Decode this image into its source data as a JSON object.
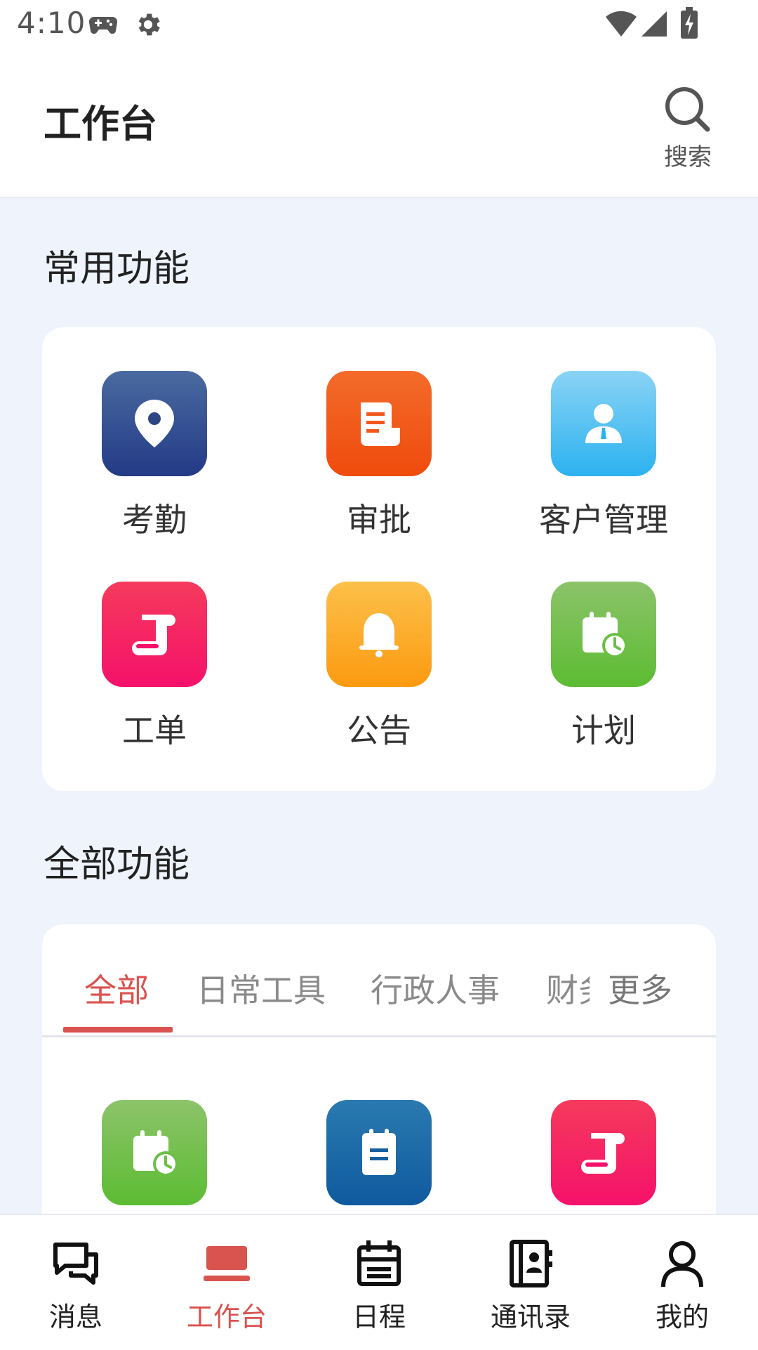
{
  "status_bar": {
    "time": "4:10"
  },
  "header": {
    "title": "工作台",
    "search_label": "搜索"
  },
  "frequent": {
    "title": "常用功能",
    "items": [
      {
        "label": "考勤",
        "icon": "location-pin-icon",
        "color": "#2c4585"
      },
      {
        "label": "审批",
        "icon": "document-icon",
        "color": "#f2571c"
      },
      {
        "label": "客户管理",
        "icon": "person-icon",
        "color": "#3cb8f0"
      },
      {
        "label": "工单",
        "icon": "scroll-icon",
        "color": "#f51e63"
      },
      {
        "label": "公告",
        "icon": "bell-icon",
        "color": "#fca51f"
      },
      {
        "label": "计划",
        "icon": "calendar-clock-icon",
        "color": "#6bbf45"
      }
    ]
  },
  "all": {
    "title": "全部功能",
    "tabs": [
      "全部",
      "日常工具",
      "行政人事",
      "财务",
      "更多"
    ],
    "active_tab": "全部",
    "items": [
      {
        "icon": "calendar-clock-icon",
        "color": "#6bbf45"
      },
      {
        "icon": "clipboard-icon",
        "color": "#1760a0"
      },
      {
        "icon": "scroll-icon",
        "color": "#f51e63"
      }
    ]
  },
  "bottom_nav": {
    "items": [
      {
        "label": "消息",
        "icon": "chat-icon"
      },
      {
        "label": "工作台",
        "icon": "workbench-icon",
        "active": true
      },
      {
        "label": "日程",
        "icon": "calendar-icon"
      },
      {
        "label": "通讯录",
        "icon": "contacts-icon"
      },
      {
        "label": "我的",
        "icon": "profile-icon"
      }
    ],
    "active_color": "#d9534f"
  }
}
